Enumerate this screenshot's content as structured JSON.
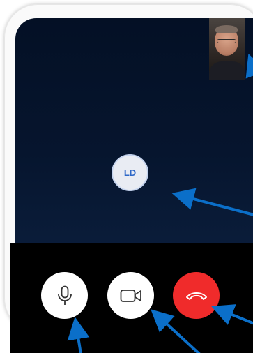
{
  "call": {
    "remote_initials": "LD"
  },
  "controls": {
    "mic_icon": "microphone-icon",
    "camera_icon": "video-camera-icon",
    "end_icon": "hang-up-icon"
  },
  "colors": {
    "end_call": "#f02b2b",
    "avatar_text": "#2d67c7",
    "annotation_arrow": "#0b6fc9",
    "screen_bg": "#06152e"
  }
}
